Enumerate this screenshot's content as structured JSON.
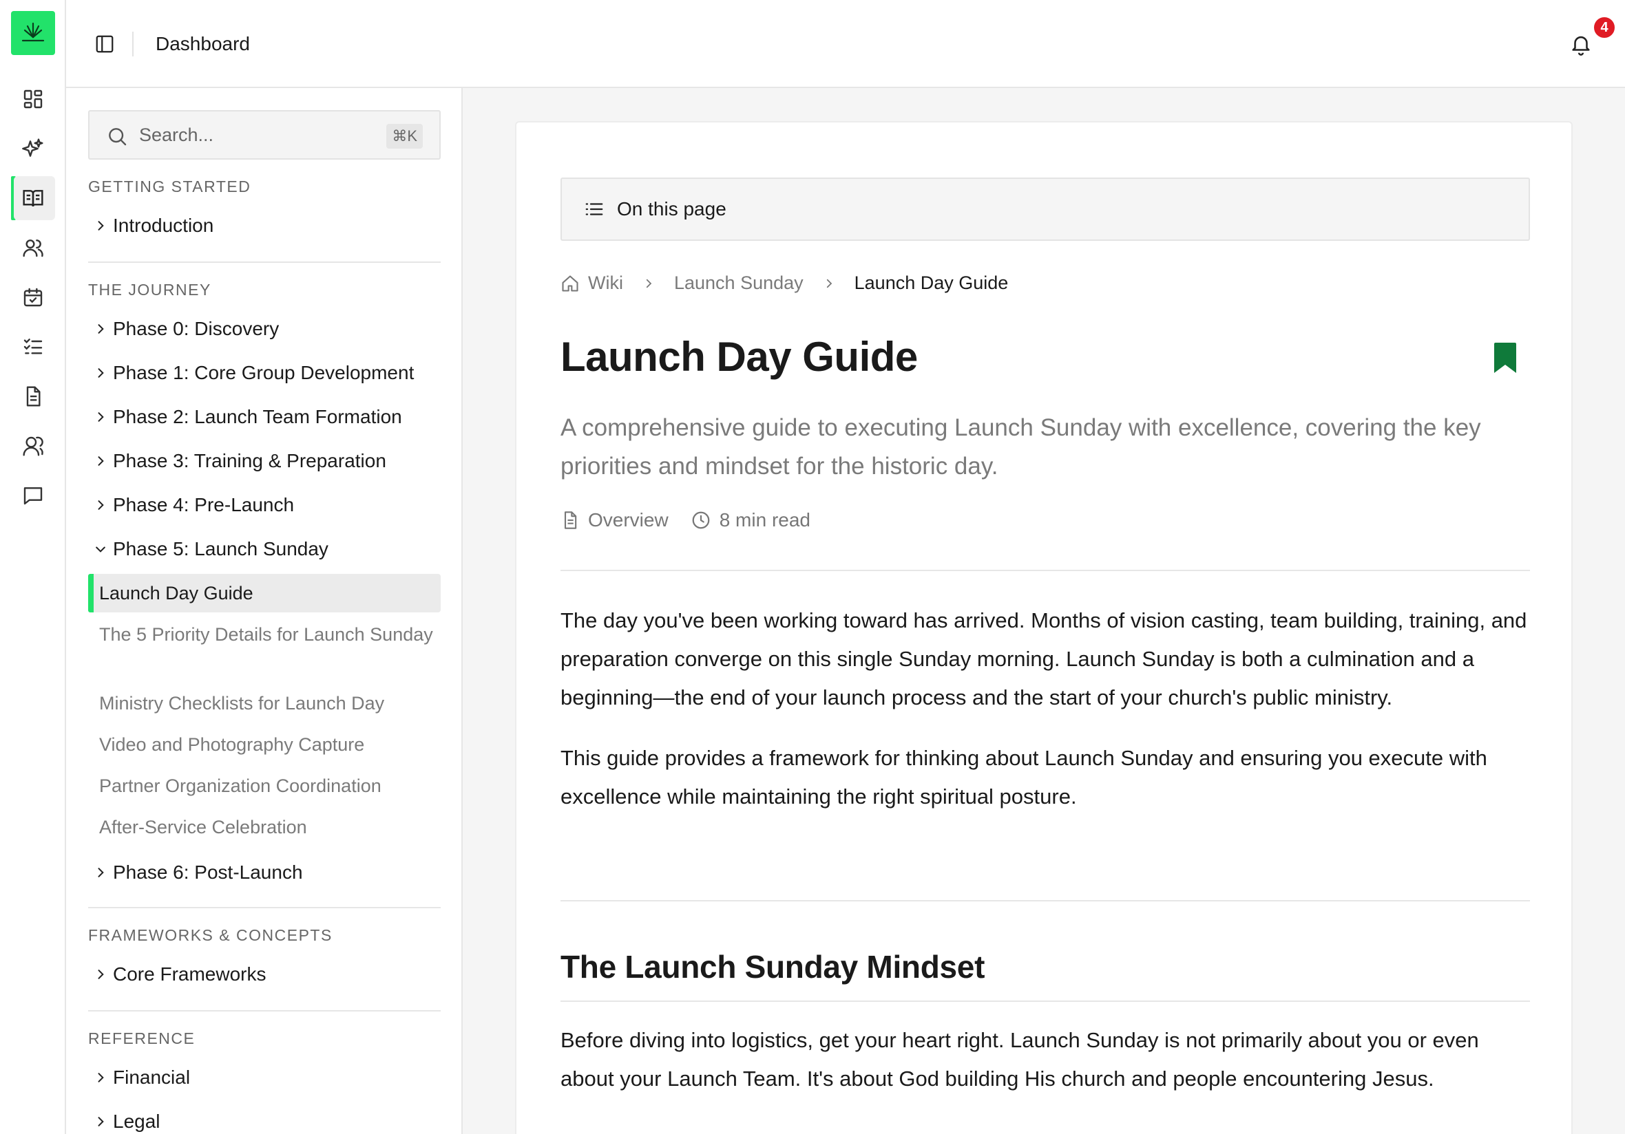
{
  "colors": {
    "accent": "#22e26a",
    "bookmark": "#0f7a3a",
    "badge": "#e01b24",
    "text": "#1a1a1a",
    "muted": "#7a7a7a"
  },
  "rail": {
    "items": [
      {
        "icon": "dashboard-icon"
      },
      {
        "icon": "sparkle-icon"
      },
      {
        "icon": "book-open-icon",
        "active": true
      },
      {
        "icon": "users-icon"
      },
      {
        "icon": "calendar-check-icon"
      },
      {
        "icon": "checklist-icon"
      },
      {
        "icon": "document-icon"
      },
      {
        "icon": "user-group-icon"
      },
      {
        "icon": "chat-icon"
      }
    ]
  },
  "topbar": {
    "title": "Dashboard",
    "notification_count": "4"
  },
  "sidebar": {
    "search": {
      "placeholder": "Search...",
      "shortcut": "⌘K"
    },
    "sections": {
      "getting_started": {
        "label": "GETTING STARTED",
        "items": [
          "Introduction"
        ]
      },
      "journey": {
        "label": "THE JOURNEY",
        "items": [
          "Phase 0: Discovery",
          "Phase 1: Core Group Development",
          "Phase 2: Launch Team Formation",
          "Phase 3: Training & Preparation",
          "Phase 4: Pre-Launch",
          "Phase 5: Launch Sunday"
        ],
        "phase5_children": [
          "Launch Day Guide",
          "The 5 Priority Details for Launch Sunday",
          "Ministry Checklists for Launch Day",
          "Video and Photography Capture",
          "Partner Organization Coordination",
          "After-Service Celebration"
        ],
        "after_items": [
          "Phase 6: Post-Launch"
        ]
      },
      "frameworks": {
        "label": "FRAMEWORKS & CONCEPTS",
        "items": [
          "Core Frameworks"
        ]
      },
      "reference": {
        "label": "REFERENCE",
        "items": [
          "Financial",
          "Legal"
        ]
      }
    }
  },
  "content": {
    "on_this_page": "On this page",
    "breadcrumb": [
      "Wiki",
      "Launch Sunday",
      "Launch Day Guide"
    ],
    "title": "Launch Day Guide",
    "subtitle": "A comprehensive guide to executing Launch Sunday with excellence, covering the key priorities and mindset for the historic day.",
    "meta": {
      "category": "Overview",
      "read_time": "8 min read"
    },
    "paragraphs": [
      "The day you've been working toward has arrived. Months of vision casting, team building, training, and preparation converge on this single Sunday morning. Launch Sunday is both a culmination and a beginning—the end of your launch process and the start of your church's public ministry.",
      "This guide provides a framework for thinking about Launch Sunday and ensuring you execute with excellence while maintaining the right spiritual posture."
    ],
    "section_heading": "The Launch Sunday Mindset",
    "section_paragraph": "Before diving into logistics, get your heart right. Launch Sunday is not primarily about you or even about your Launch Team. It's about God building His church and people encountering Jesus."
  }
}
